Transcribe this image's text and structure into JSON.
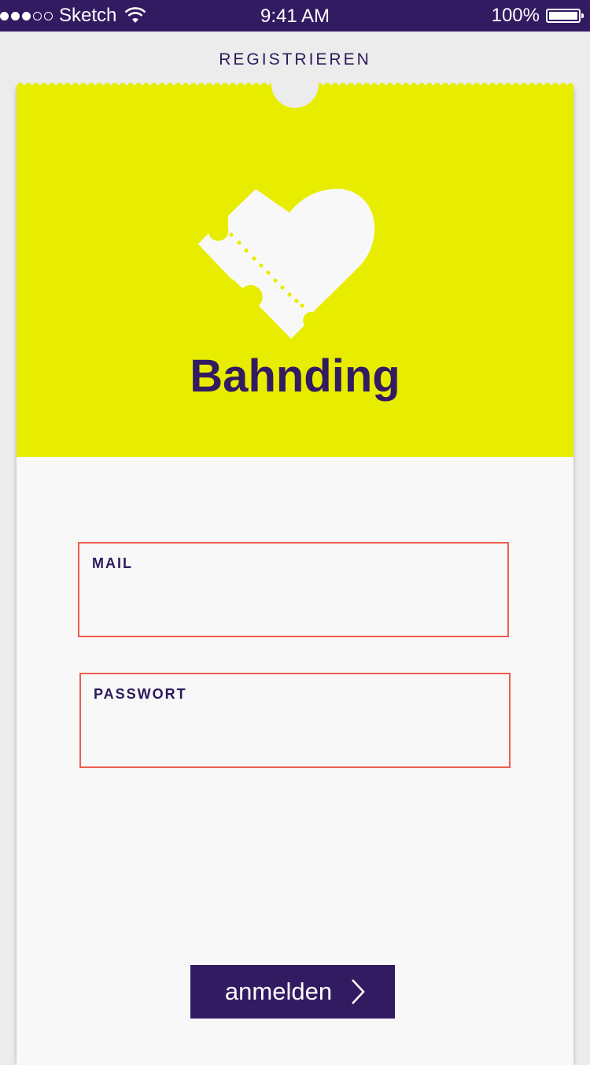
{
  "status_bar": {
    "carrier": "Sketch",
    "time": "9:41 AM",
    "battery": "100%",
    "signal_bars_filled": 3,
    "signal_bars_total": 5
  },
  "nav": {
    "title": "REGISTRIEREN"
  },
  "brand": {
    "name": "Bahnding",
    "icon": "ticket-heart-icon"
  },
  "form": {
    "mail": {
      "label": "MAIL",
      "value": "",
      "placeholder": ""
    },
    "password": {
      "label": "PASSWORT",
      "value": "",
      "placeholder": ""
    }
  },
  "login_button": {
    "label": "anmelden",
    "icon": "chevron-right-icon"
  },
  "colors": {
    "primary": "#331b62",
    "accent": "#e8ed00",
    "field_border": "#ee5e4f",
    "background": "#ececec",
    "card": "#f8f8f8"
  }
}
